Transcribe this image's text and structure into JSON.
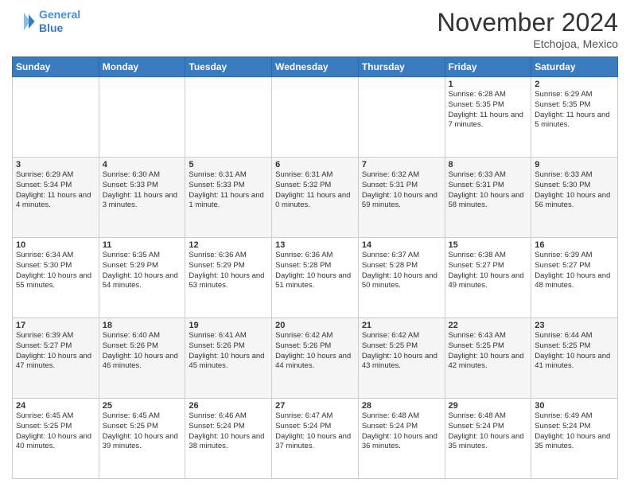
{
  "header": {
    "logo_line1": "General",
    "logo_line2": "Blue",
    "month_title": "November 2024",
    "location": "Etchojoa, Mexico"
  },
  "weekdays": [
    "Sunday",
    "Monday",
    "Tuesday",
    "Wednesday",
    "Thursday",
    "Friday",
    "Saturday"
  ],
  "weeks": [
    [
      {
        "day": "",
        "text": ""
      },
      {
        "day": "",
        "text": ""
      },
      {
        "day": "",
        "text": ""
      },
      {
        "day": "",
        "text": ""
      },
      {
        "day": "",
        "text": ""
      },
      {
        "day": "1",
        "text": "Sunrise: 6:28 AM\nSunset: 5:35 PM\nDaylight: 11 hours and 7 minutes."
      },
      {
        "day": "2",
        "text": "Sunrise: 6:29 AM\nSunset: 5:35 PM\nDaylight: 11 hours and 5 minutes."
      }
    ],
    [
      {
        "day": "3",
        "text": "Sunrise: 6:29 AM\nSunset: 5:34 PM\nDaylight: 11 hours and 4 minutes."
      },
      {
        "day": "4",
        "text": "Sunrise: 6:30 AM\nSunset: 5:33 PM\nDaylight: 11 hours and 3 minutes."
      },
      {
        "day": "5",
        "text": "Sunrise: 6:31 AM\nSunset: 5:33 PM\nDaylight: 11 hours and 1 minute."
      },
      {
        "day": "6",
        "text": "Sunrise: 6:31 AM\nSunset: 5:32 PM\nDaylight: 11 hours and 0 minutes."
      },
      {
        "day": "7",
        "text": "Sunrise: 6:32 AM\nSunset: 5:31 PM\nDaylight: 10 hours and 59 minutes."
      },
      {
        "day": "8",
        "text": "Sunrise: 6:33 AM\nSunset: 5:31 PM\nDaylight: 10 hours and 58 minutes."
      },
      {
        "day": "9",
        "text": "Sunrise: 6:33 AM\nSunset: 5:30 PM\nDaylight: 10 hours and 56 minutes."
      }
    ],
    [
      {
        "day": "10",
        "text": "Sunrise: 6:34 AM\nSunset: 5:30 PM\nDaylight: 10 hours and 55 minutes."
      },
      {
        "day": "11",
        "text": "Sunrise: 6:35 AM\nSunset: 5:29 PM\nDaylight: 10 hours and 54 minutes."
      },
      {
        "day": "12",
        "text": "Sunrise: 6:36 AM\nSunset: 5:29 PM\nDaylight: 10 hours and 53 minutes."
      },
      {
        "day": "13",
        "text": "Sunrise: 6:36 AM\nSunset: 5:28 PM\nDaylight: 10 hours and 51 minutes."
      },
      {
        "day": "14",
        "text": "Sunrise: 6:37 AM\nSunset: 5:28 PM\nDaylight: 10 hours and 50 minutes."
      },
      {
        "day": "15",
        "text": "Sunrise: 6:38 AM\nSunset: 5:27 PM\nDaylight: 10 hours and 49 minutes."
      },
      {
        "day": "16",
        "text": "Sunrise: 6:39 AM\nSunset: 5:27 PM\nDaylight: 10 hours and 48 minutes."
      }
    ],
    [
      {
        "day": "17",
        "text": "Sunrise: 6:39 AM\nSunset: 5:27 PM\nDaylight: 10 hours and 47 minutes."
      },
      {
        "day": "18",
        "text": "Sunrise: 6:40 AM\nSunset: 5:26 PM\nDaylight: 10 hours and 46 minutes."
      },
      {
        "day": "19",
        "text": "Sunrise: 6:41 AM\nSunset: 5:26 PM\nDaylight: 10 hours and 45 minutes."
      },
      {
        "day": "20",
        "text": "Sunrise: 6:42 AM\nSunset: 5:26 PM\nDaylight: 10 hours and 44 minutes."
      },
      {
        "day": "21",
        "text": "Sunrise: 6:42 AM\nSunset: 5:25 PM\nDaylight: 10 hours and 43 minutes."
      },
      {
        "day": "22",
        "text": "Sunrise: 6:43 AM\nSunset: 5:25 PM\nDaylight: 10 hours and 42 minutes."
      },
      {
        "day": "23",
        "text": "Sunrise: 6:44 AM\nSunset: 5:25 PM\nDaylight: 10 hours and 41 minutes."
      }
    ],
    [
      {
        "day": "24",
        "text": "Sunrise: 6:45 AM\nSunset: 5:25 PM\nDaylight: 10 hours and 40 minutes."
      },
      {
        "day": "25",
        "text": "Sunrise: 6:45 AM\nSunset: 5:25 PM\nDaylight: 10 hours and 39 minutes."
      },
      {
        "day": "26",
        "text": "Sunrise: 6:46 AM\nSunset: 5:24 PM\nDaylight: 10 hours and 38 minutes."
      },
      {
        "day": "27",
        "text": "Sunrise: 6:47 AM\nSunset: 5:24 PM\nDaylight: 10 hours and 37 minutes."
      },
      {
        "day": "28",
        "text": "Sunrise: 6:48 AM\nSunset: 5:24 PM\nDaylight: 10 hours and 36 minutes."
      },
      {
        "day": "29",
        "text": "Sunrise: 6:48 AM\nSunset: 5:24 PM\nDaylight: 10 hours and 35 minutes."
      },
      {
        "day": "30",
        "text": "Sunrise: 6:49 AM\nSunset: 5:24 PM\nDaylight: 10 hours and 35 minutes."
      }
    ]
  ]
}
